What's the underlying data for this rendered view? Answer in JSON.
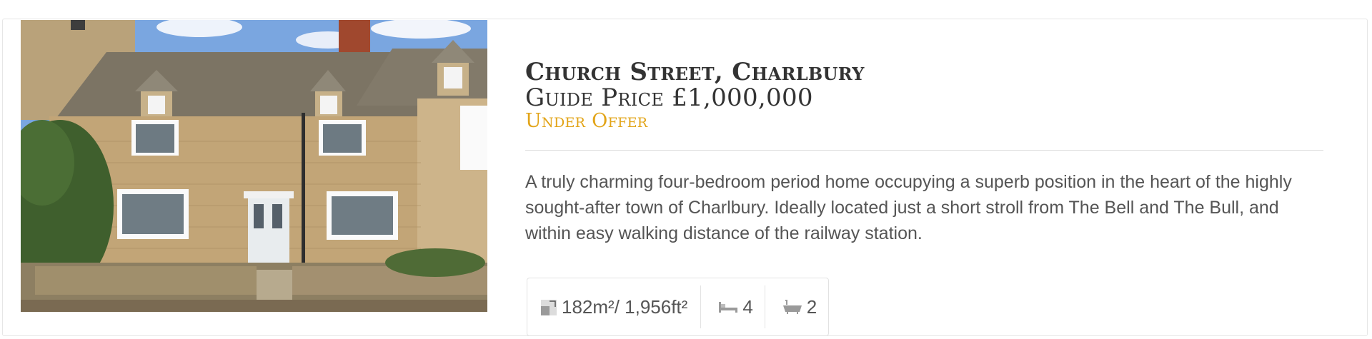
{
  "listing": {
    "address": "Church Street, Charlbury",
    "price": "Guide Price £1,000,000",
    "status": "Under Offer",
    "description": "A truly charming four-bedroom period home occupying a superb position in the heart of the highly sought-after town of Charlbury. Ideally located just a short stroll from The Bell and The Bull, and within easy walking distance of the railway station.",
    "stats": {
      "area": "182m²/ 1,956ft²",
      "bedrooms": "4",
      "bathrooms": "2"
    }
  },
  "icons": {
    "area": "floor-area-icon",
    "bedrooms": "bed-icon",
    "bathrooms": "bath-icon"
  },
  "colors": {
    "status": "#e2a418",
    "text": "#555555",
    "heading": "#333333"
  }
}
